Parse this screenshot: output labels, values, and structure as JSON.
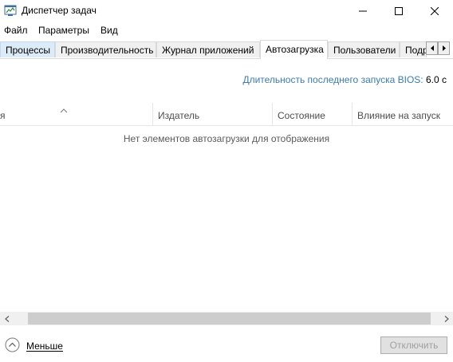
{
  "window": {
    "title": "Диспетчер задач",
    "icon": "task-manager-icon"
  },
  "menu": {
    "items": [
      "Файл",
      "Параметры",
      "Вид"
    ]
  },
  "tabs": {
    "items": [
      "Процессы",
      "Производительность",
      "Журнал приложений",
      "Автозагрузка",
      "Пользователи",
      "Подр"
    ],
    "active": "Автозагрузка"
  },
  "bios": {
    "label": "Длительность последнего запуска BIOS:",
    "value": "6.0 с"
  },
  "table": {
    "columns": [
      "я",
      "Издатель",
      "Состояние",
      "Влияние на запуск"
    ],
    "empty_message": "Нет элементов автозагрузки для отображения"
  },
  "footer": {
    "less_label": "Меньше",
    "disable_label": "Отключить"
  },
  "colors": {
    "accent_blue": "#3c7bb3",
    "active_tab_highlight": "#dcebf8"
  }
}
